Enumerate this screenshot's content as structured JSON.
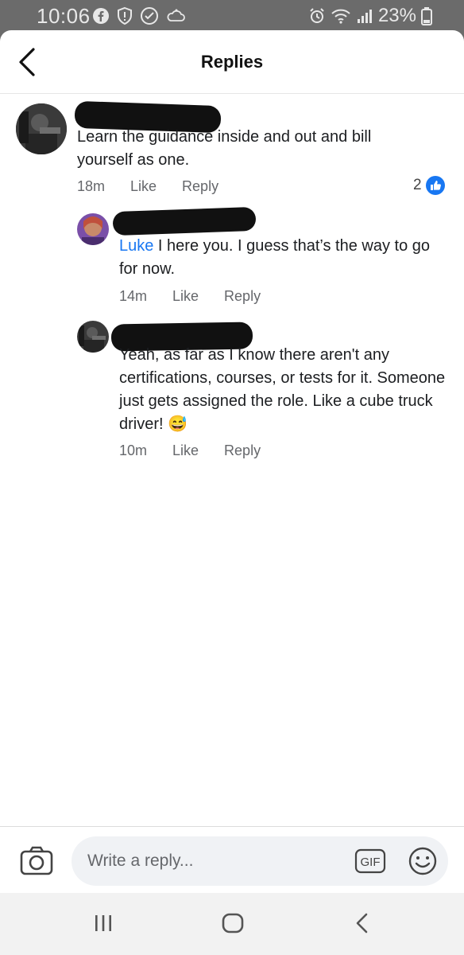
{
  "status_bar": {
    "time": "10:06",
    "battery": "23%"
  },
  "header": {
    "title": "Replies"
  },
  "comments": [
    {
      "text": "Learn the guidance inside and out and bill yourself as one.",
      "time": "18m",
      "like_label": "Like",
      "reply_label": "Reply",
      "reaction_count": "2"
    },
    {
      "mention": "Luke",
      "text": " I here you. I guess that’s the way to go for now.",
      "time": "14m",
      "like_label": "Like",
      "reply_label": "Reply"
    },
    {
      "text": "Yeah, as far as I know there aren't any certifications, courses, or tests for it. Someone just gets assigned the role. Like a cube truck driver! 😅",
      "time": "10m",
      "like_label": "Like",
      "reply_label": "Reply"
    }
  ],
  "composer": {
    "placeholder": "Write a reply...",
    "gif_label": "GIF"
  },
  "colors": {
    "accent": "#1877f2",
    "status_bar": "#6b6b6b",
    "muted_text": "#65676b"
  }
}
